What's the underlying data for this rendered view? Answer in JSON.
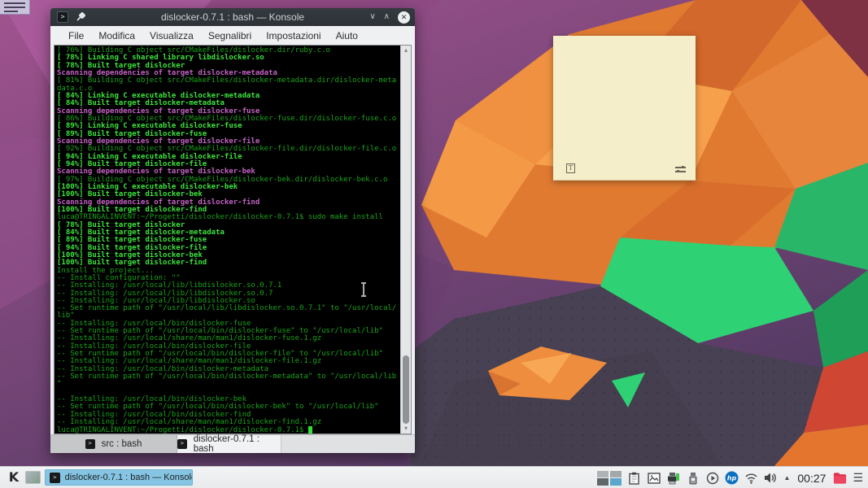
{
  "window": {
    "title": "dislocker-0.7.1 : bash — Konsole",
    "menu": [
      "File",
      "Modifica",
      "Visualizza",
      "Segnalibri",
      "Impostazioni",
      "Aiuto"
    ],
    "tabs": [
      {
        "label": "src : bash",
        "active": false
      },
      {
        "label": "dislocker-0.7.1 : bash",
        "active": true
      }
    ],
    "titlebar_buttons": [
      "minimize",
      "maximize",
      "close"
    ]
  },
  "terminal": {
    "columns": 77,
    "color_scheme": {
      "background": "#000000",
      "green": "#19a519",
      "green_bright": "#3ce43c",
      "magenta": "#c462c4"
    },
    "lines": [
      {
        "t": "[ 76%] Building C object src/CMakeFiles/dislocker.dir/ruby.c.o",
        "c": "dim"
      },
      {
        "t": "[ 78%] Linking C shared library libdislocker.so",
        "c": "bold"
      },
      {
        "t": "[ 78%] Built target dislocker",
        "c": "bold"
      },
      {
        "t": "Scanning dependencies of target dislocker-metadata",
        "c": "mag"
      },
      {
        "t": "[ 81%] Building C object src/CMakeFiles/dislocker-metadata.dir/dislocker-meta",
        "c": "dim"
      },
      {
        "t": "data.c.o",
        "c": "dim"
      },
      {
        "t": "[ 84%] Linking C executable dislocker-metadata",
        "c": "bold"
      },
      {
        "t": "[ 84%] Built target dislocker-metadata",
        "c": "bold"
      },
      {
        "t": "Scanning dependencies of target dislocker-fuse",
        "c": "mag"
      },
      {
        "t": "[ 86%] Building C object src/CMakeFiles/dislocker-fuse.dir/dislocker-fuse.c.o",
        "c": "dim"
      },
      {
        "t": "[ 89%] Linking C executable dislocker-fuse",
        "c": "bold"
      },
      {
        "t": "[ 89%] Built target dislocker-fuse",
        "c": "bold"
      },
      {
        "t": "Scanning dependencies of target dislocker-file",
        "c": "mag"
      },
      {
        "t": "[ 92%] Building C object src/CMakeFiles/dislocker-file.dir/dislocker-file.c.o",
        "c": "dim"
      },
      {
        "t": "[ 94%] Linking C executable dislocker-file",
        "c": "bold"
      },
      {
        "t": "[ 94%] Built target dislocker-file",
        "c": "bold"
      },
      {
        "t": "Scanning dependencies of target dislocker-bek",
        "c": "mag"
      },
      {
        "t": "[ 97%] Building C object src/CMakeFiles/dislocker-bek.dir/dislocker-bek.c.o",
        "c": "dim"
      },
      {
        "t": "[100%] Linking C executable dislocker-bek",
        "c": "bold"
      },
      {
        "t": "[100%] Built target dislocker-bek",
        "c": "bold"
      },
      {
        "t": "Scanning dependencies of target dislocker-find",
        "c": "mag"
      },
      {
        "t": "[100%] Built target dislocker-find",
        "c": "bold"
      },
      {
        "t": "luca@TRINGALINVENT:~/Progetti/dislocker/dislocker-0.7.1$ sudo make install",
        "c": "dim"
      },
      {
        "t": "[ 78%] Built target dislocker",
        "c": "bold"
      },
      {
        "t": "[ 84%] Built target dislocker-metadata",
        "c": "bold"
      },
      {
        "t": "[ 89%] Built target dislocker-fuse",
        "c": "bold"
      },
      {
        "t": "[ 94%] Built target dislocker-file",
        "c": "bold"
      },
      {
        "t": "[100%] Built target dislocker-bek",
        "c": "bold"
      },
      {
        "t": "[100%] Built target dislocker-find",
        "c": "bold"
      },
      {
        "t": "Install the project...",
        "c": "dim"
      },
      {
        "t": "-- Install configuration: \"\"",
        "c": "dim"
      },
      {
        "t": "-- Installing: /usr/local/lib/libdislocker.so.0.7.1",
        "c": "dim"
      },
      {
        "t": "-- Installing: /usr/local/lib/libdislocker.so.0.7",
        "c": "dim"
      },
      {
        "t": "-- Installing: /usr/local/lib/libdislocker.so",
        "c": "dim"
      },
      {
        "t": "-- Set runtime path of \"/usr/local/lib/libdislocker.so.0.7.1\" to \"/usr/local/",
        "c": "dim"
      },
      {
        "t": "lib\"",
        "c": "dim"
      },
      {
        "t": "-- Installing: /usr/local/bin/dislocker-fuse",
        "c": "dim"
      },
      {
        "t": "-- Set runtime path of \"/usr/local/bin/dislocker-fuse\" to \"/usr/local/lib\"",
        "c": "dim"
      },
      {
        "t": "-- Installing: /usr/local/share/man/man1/dislocker-fuse.1.gz",
        "c": "dim"
      },
      {
        "t": "-- Installing: /usr/local/bin/dislocker-file",
        "c": "dim"
      },
      {
        "t": "-- Set runtime path of \"/usr/local/bin/dislocker-file\" to \"/usr/local/lib\"",
        "c": "dim"
      },
      {
        "t": "-- Installing: /usr/local/share/man/man1/dislocker-file.1.gz",
        "c": "dim"
      },
      {
        "t": "-- Installing: /usr/local/bin/dislocker-metadata",
        "c": "dim"
      },
      {
        "t": "-- Set runtime path of \"/usr/local/bin/dislocker-metadata\" to \"/usr/local/lib",
        "c": "dim"
      },
      {
        "t": "\"",
        "c": "dim"
      },
      {
        "t": "",
        "c": "dim"
      },
      {
        "t": "-- Installing: /usr/local/bin/dislocker-bek",
        "c": "dim"
      },
      {
        "t": "-- Set runtime path of \"/usr/local/bin/dislocker-bek\" to \"/usr/local/lib\"",
        "c": "dim"
      },
      {
        "t": "-- Installing: /usr/local/bin/dislocker-find",
        "c": "dim"
      },
      {
        "t": "-- Installing: /usr/local/share/man/man1/dislocker-find.1.gz",
        "c": "dim"
      },
      {
        "t": "luca@TRINGALINVENT:~/Progetti/dislocker/dislocker-0.7.1$ ",
        "c": "dim",
        "cursor": true
      }
    ]
  },
  "taskbar": {
    "task_button": "dislocker-0.7.1 : bash — Konsole",
    "clock": "00:27",
    "tray_icons": [
      "virtual-desktop-pager",
      "clipboard",
      "screenshot",
      "printer",
      "removable-device",
      "media-player",
      "hp-device",
      "wifi",
      "volume",
      "expand-arrow",
      "clock",
      "downloads-folder",
      "menu"
    ],
    "active_task_color": "#85c4e2"
  },
  "sticky_note": {
    "text": "",
    "background": "#f4eeca",
    "icons": [
      "format-text",
      "settings"
    ]
  },
  "desktop": {
    "wallpaper_palette": {
      "purple": "#9c4f90",
      "orange": "#e07a31",
      "green": "#2ed173",
      "dark_slate": "#484153",
      "red": "#cf4733"
    }
  }
}
